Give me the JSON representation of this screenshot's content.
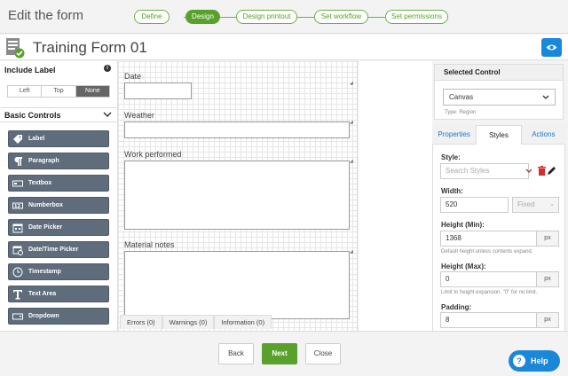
{
  "header": {
    "heading": "Edit the form"
  },
  "steps": [
    {
      "label": "Define",
      "active": false
    },
    {
      "label": "Design",
      "active": true
    },
    {
      "label": "Design printout",
      "active": false
    },
    {
      "label": "Set workflow",
      "active": false
    },
    {
      "label": "Set permissions",
      "active": false
    }
  ],
  "form": {
    "title": "Training Form 01"
  },
  "colors": {
    "accent_green": "#5aa02c",
    "accent_blue": "#1b87d8",
    "control_gray": "#5e6c7b"
  },
  "left_panel": {
    "include_label": "Include Label",
    "label_options": [
      "Left",
      "Top",
      "None"
    ],
    "selected_option": "None",
    "basic_controls": "Basic Controls",
    "controls": [
      {
        "label": "Label",
        "icon": "tag-icon"
      },
      {
        "label": "Paragraph",
        "icon": "paragraph-icon"
      },
      {
        "label": "Textbox",
        "icon": "textbox-icon"
      },
      {
        "label": "Numberbox",
        "icon": "numberbox-icon"
      },
      {
        "label": "Date Picker",
        "icon": "calendar-icon"
      },
      {
        "label": "Date/Time Picker",
        "icon": "calendar-clock-icon"
      },
      {
        "label": "Timestamp",
        "icon": "clock-icon"
      },
      {
        "label": "Text Area",
        "icon": "text-area-icon"
      },
      {
        "label": "Dropdown",
        "icon": "dropdown-icon"
      }
    ]
  },
  "canvas": {
    "fields": [
      {
        "label": "Date"
      },
      {
        "label": "Weather"
      },
      {
        "label": "Work performed"
      },
      {
        "label": "Material notes"
      }
    ]
  },
  "bottom_tabs": [
    "Errors (0)",
    "Warnings (0)",
    "Information (0)"
  ],
  "right_panel": {
    "selected_control_title": "Selected Control",
    "selected_control_value": "Canvas",
    "type_text": "Type: Region",
    "tabs": [
      "Properties",
      "Styles",
      "Actions"
    ],
    "active_tab": "Styles",
    "style_label": "Style:",
    "style_placeholder": "Search Styles",
    "width_label": "Width:",
    "width_value": "520",
    "width_unit": "Fixed",
    "height_min_label": "Height (Min):",
    "height_min_value": "1368",
    "height_min_unit": "px",
    "height_min_help": "Default height unless contents expand.",
    "height_max_label": "Height (Max):",
    "height_max_value": "0",
    "height_max_unit": "px",
    "height_max_help": "Limit to height expansion. \"0\" for no limit.",
    "padding_label": "Padding:",
    "padding_value": "8",
    "padding_unit": "px"
  },
  "footer": {
    "back": "Back",
    "next": "Next",
    "close": "Close",
    "help": "Help"
  }
}
